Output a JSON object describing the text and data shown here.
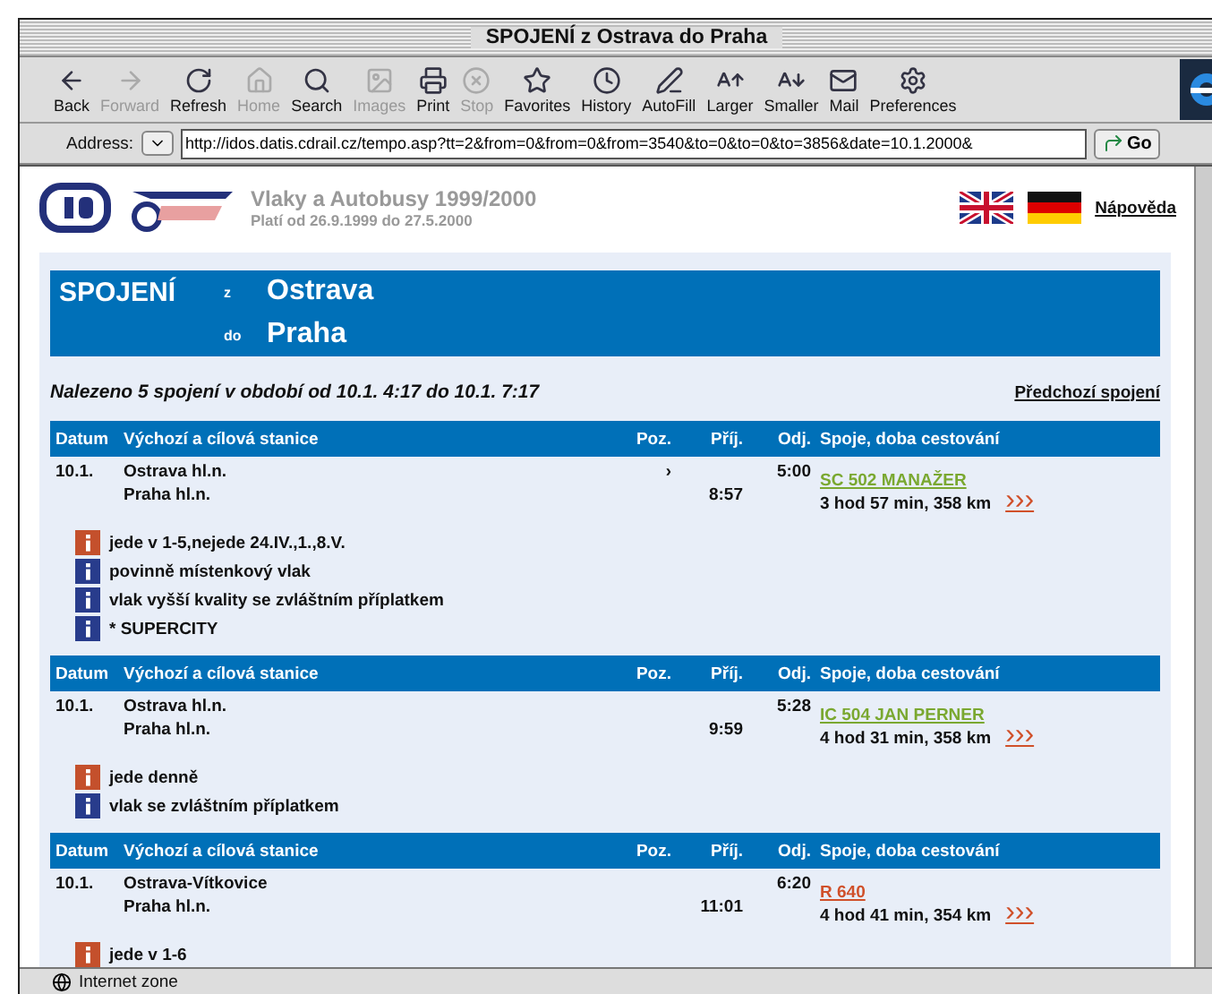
{
  "window": {
    "title": "SPOJENÍ z Ostrava do Praha"
  },
  "toolbar": [
    {
      "label": "Back",
      "disabled": false
    },
    {
      "label": "Forward",
      "disabled": true
    },
    {
      "label": "Refresh",
      "disabled": false
    },
    {
      "label": "Home",
      "disabled": true
    },
    {
      "label": "Search",
      "disabled": false
    },
    {
      "label": "Images",
      "disabled": true
    },
    {
      "label": "Print",
      "disabled": false
    },
    {
      "label": "Stop",
      "disabled": true
    },
    {
      "label": "Favorites",
      "disabled": false
    },
    {
      "label": "History",
      "disabled": false
    },
    {
      "label": "AutoFill",
      "disabled": false
    },
    {
      "label": "Larger",
      "disabled": false
    },
    {
      "label": "Smaller",
      "disabled": false
    },
    {
      "label": "Mail",
      "disabled": false
    },
    {
      "label": "Preferences",
      "disabled": false
    }
  ],
  "address": {
    "label": "Address:",
    "value": "http://idos.datis.cdrail.cz/tempo.asp?tt=2&from=0&from=0&from=3540&to=0&to=0&to=3856&date=10.1.2000&",
    "go": "Go"
  },
  "site": {
    "title": "Vlaky a Autobusy 1999/2000",
    "validity": "Platí od 26.9.1999 do 27.5.2000",
    "help": "Nápověda"
  },
  "route": {
    "heading": "SPOJENÍ",
    "from_label": "z",
    "from": "Ostrava",
    "to_label": "do",
    "to": "Praha"
  },
  "summary": "Nalezeno 5 spojení v období od 10.1. 4:17 do 10.1. 7:17",
  "previous_link": "Předchozí spojení",
  "connections": [
    {
      "columns": [
        "Datum",
        "Výchozí a cílová stanice",
        "Poz.",
        "Příj.",
        "Odj.",
        "Spoje, doba cestování"
      ],
      "date": "10.1.",
      "from": "Ostrava hl.n.",
      "to": "Praha hl.n.",
      "position": "›",
      "arrival": "8:57",
      "departure": "5:00",
      "train": {
        "label": "SC 502 MANAŽER",
        "color": "#7aa830"
      },
      "duration": "3 hod 57 min, 358 km",
      "more": "›››",
      "notes": [
        {
          "text": "jede v 1-5,nejede 24.IV.,1.,8.V.",
          "color": "#c4502c"
        },
        {
          "text": "povinně místenkový vlak",
          "color": "#283c8c"
        },
        {
          "text": "vlak vyšší kvality se zvláštním příplatkem",
          "color": "#283c8c"
        },
        {
          "text": "* SUPERCITY",
          "color": "#283c8c"
        }
      ]
    },
    {
      "columns": [
        "Datum",
        "Výchozí a cílová stanice",
        "Poz.",
        "Příj.",
        "Odj.",
        "Spoje, doba cestování"
      ],
      "date": "10.1.",
      "from": "Ostrava hl.n.",
      "to": "Praha hl.n.",
      "arrival": "9:59",
      "departure": "5:28",
      "train": {
        "label": "IC 504 JAN PERNER",
        "color": "#7aa830"
      },
      "duration": "4 hod 31 min, 358 km",
      "more": "›››",
      "notes": [
        {
          "text": "jede denně",
          "color": "#c4502c"
        },
        {
          "text": "vlak se zvláštním příplatkem",
          "color": "#283c8c"
        }
      ]
    },
    {
      "columns": [
        "Datum",
        "Výchozí a cílová stanice",
        "Poz.",
        "Příj.",
        "Odj.",
        "Spoje, doba cestování"
      ],
      "date": "10.1.",
      "from": "Ostrava-Vítkovice",
      "to": "Praha hl.n.",
      "arrival": "11:01",
      "departure": "6:20",
      "train": {
        "label": "R 640",
        "color": "#d0502a"
      },
      "duration": "4 hod 41 min, 354 km",
      "more": "›››",
      "notes": [
        {
          "text": "jede v 1-6",
          "color": "#c4502c"
        }
      ]
    }
  ],
  "status_bar": "Internet zone"
}
